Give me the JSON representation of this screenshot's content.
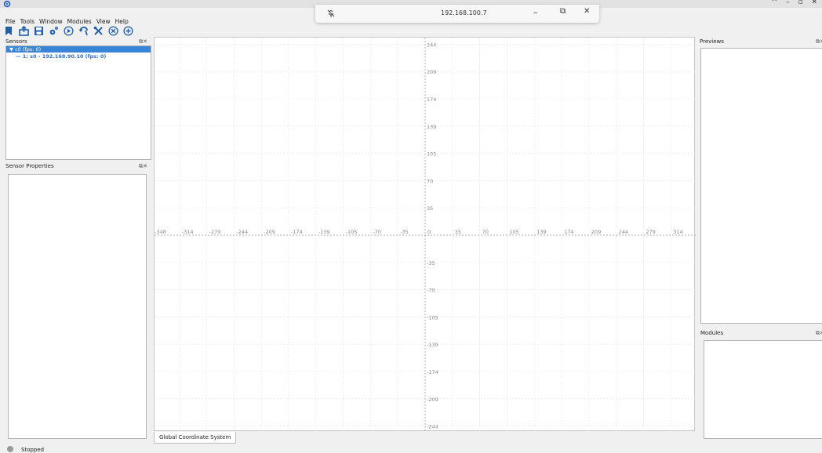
{
  "window": {
    "controls": [
      "^",
      "–",
      "▫",
      "✕"
    ]
  },
  "remote_bar": {
    "ip": "192.168.100.7",
    "minimize": "–",
    "restore": "⧉",
    "close": "✕"
  },
  "menu": [
    "File",
    "Tools",
    "Window",
    "Modules",
    "View",
    "Help"
  ],
  "toolbar": [
    "bookmark-icon",
    "export-icon",
    "save-icon",
    "settings-icon",
    "play-icon",
    "undo-icon",
    "tools-icon",
    "stop-icon",
    "add-icon"
  ],
  "sensors": {
    "title": "Sensors",
    "tree": [
      {
        "label": "c0 (fps: 0)",
        "selected": true
      },
      {
        "label": "1: s0 - 192.168.90.10 (fps: 0)",
        "selected": false
      }
    ]
  },
  "sensor_properties": {
    "title": "Sensor Properties"
  },
  "previews": {
    "title": "Previews"
  },
  "modules": {
    "title": "Modules"
  },
  "dock_buttons": "⧉✕",
  "plot": {
    "tab_label": "Global Coordinate System",
    "x_ticks": [
      "-348",
      "-314",
      "-279",
      "-244",
      "-209",
      "-174",
      "-139",
      "-105",
      "-70",
      "-35",
      "0",
      "35",
      "70",
      "105",
      "139",
      "174",
      "209",
      "244",
      "279",
      "314"
    ],
    "y_ticks": [
      "244",
      "209",
      "174",
      "139",
      "105",
      "70",
      "35",
      "-35",
      "-70",
      "-105",
      "-139",
      "-174",
      "-209",
      "-244"
    ]
  },
  "status": {
    "text": "Stopped"
  },
  "colors": {
    "selection": "#3a84d8",
    "link": "#2a6fd0",
    "toolbar_blue": "#1f5fa8"
  }
}
